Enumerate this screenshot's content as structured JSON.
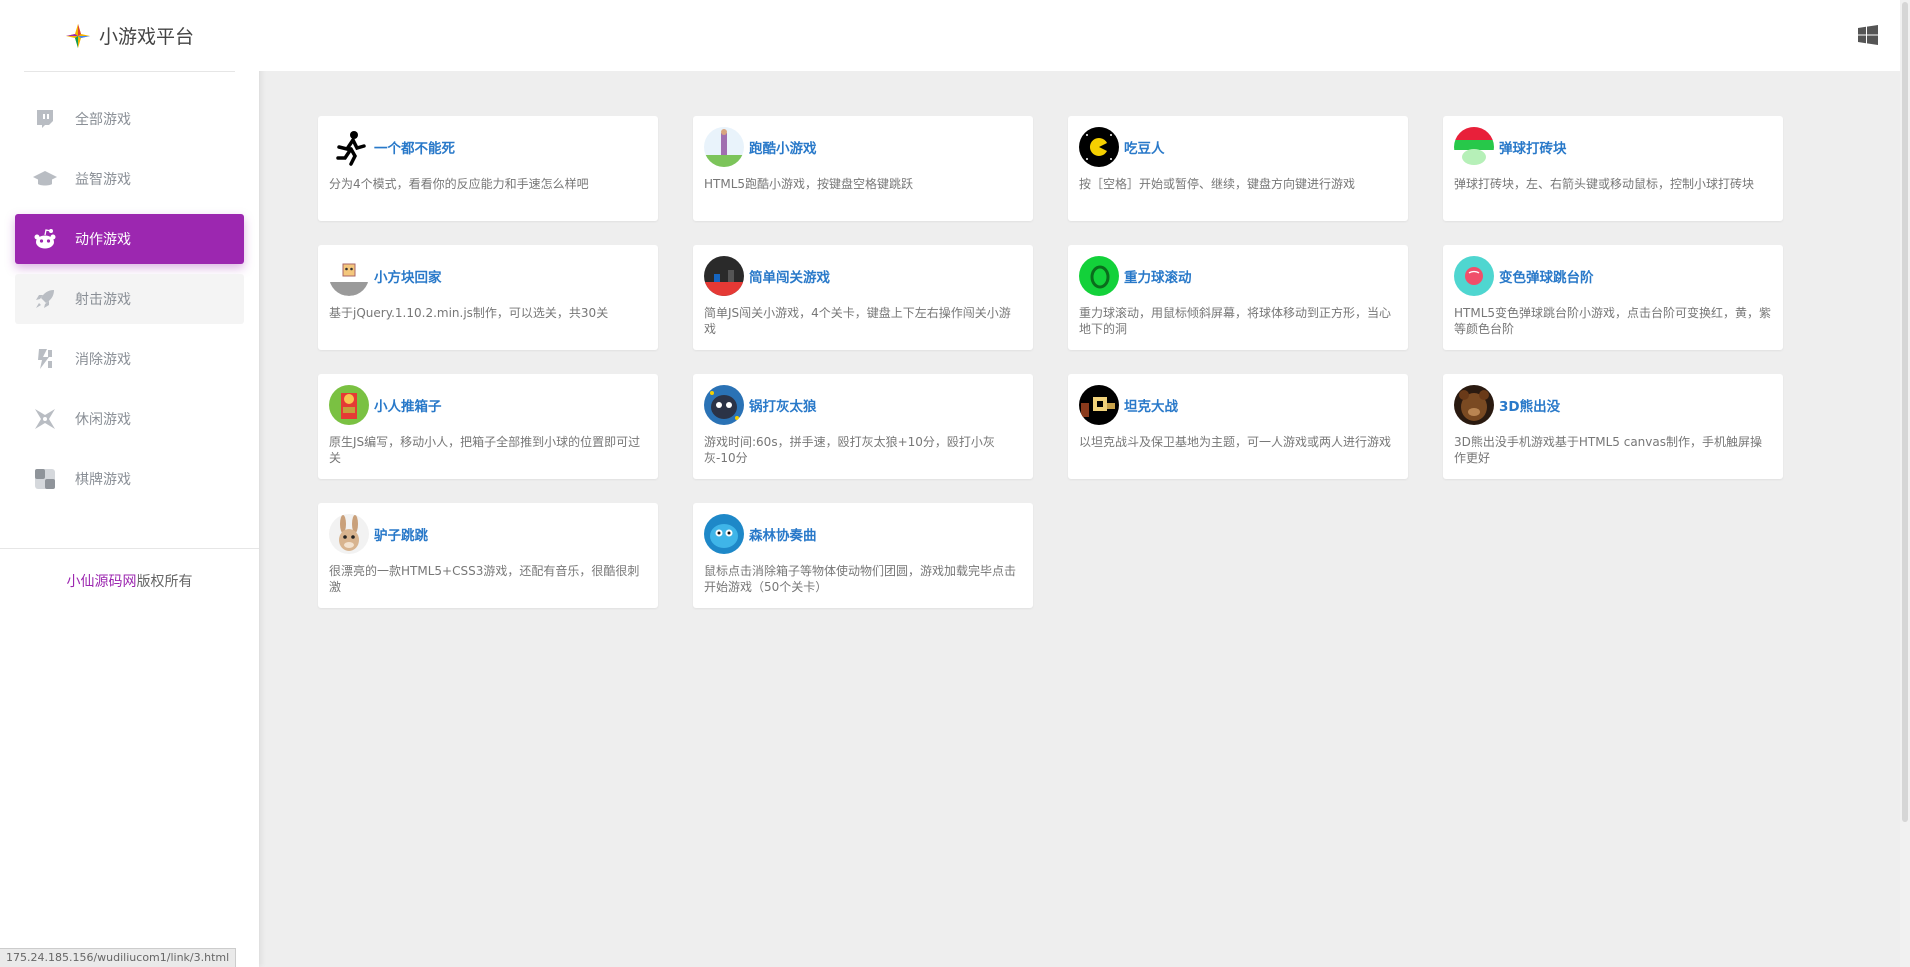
{
  "brand": {
    "title": "小游戏平台"
  },
  "nav": [
    {
      "label": "全部游戏",
      "icon": "twitch-icon"
    },
    {
      "label": "益智游戏",
      "icon": "graduation-cap-icon"
    },
    {
      "label": "动作游戏",
      "icon": "reddit-icon",
      "active": true
    },
    {
      "label": "射击游戏",
      "icon": "rocket-icon"
    },
    {
      "label": "消除游戏",
      "icon": "bolt-box-icon"
    },
    {
      "label": "休闲游戏",
      "icon": "shuriken-icon"
    },
    {
      "label": "棋牌游戏",
      "icon": "checkerboard-icon"
    }
  ],
  "copyright": {
    "link": "小仙源码网",
    "text": "版权所有"
  },
  "status_url": "175.24.185.156/wudiliucom1/link/3.html",
  "games": [
    {
      "title": "一个都不能死",
      "desc": "分为4个模式，看看你的反应能力和手速怎么样吧"
    },
    {
      "title": "跑酷小游戏",
      "desc": "HTML5跑酷小游戏，按键盘空格键跳跃"
    },
    {
      "title": "吃豆人",
      "desc": "按［空格］开始或暂停、继续，键盘方向键进行游戏"
    },
    {
      "title": "弹球打砖块",
      "desc": "弹球打砖块，左、右箭头键或移动鼠标，控制小球打砖块"
    },
    {
      "title": "小方块回家",
      "desc": "基于jQuery.1.10.2.min.js制作，可以选关，共30关"
    },
    {
      "title": "简单闯关游戏",
      "desc": "简单JS闯关小游戏，4个关卡，键盘上下左右操作闯关小游戏"
    },
    {
      "title": "重力球滚动",
      "desc": "重力球滚动，用鼠标倾斜屏幕，将球体移动到正方形，当心地下的洞"
    },
    {
      "title": "变色弹球跳台阶",
      "desc": "HTML5变色弹球跳台阶小游戏，点击台阶可变换红，黄，紫等颜色台阶"
    },
    {
      "title": "小人推箱子",
      "desc": "原生JS编写，移动小人，把箱子全部推到小球的位置即可过关"
    },
    {
      "title": "锅打灰太狼",
      "desc": "游戏时间:60s，拼手速，殴打灰太狼+10分，殴打小灰灰-10分"
    },
    {
      "title": "坦克大战",
      "desc": "以坦克战斗及保卫基地为主题，可一人游戏或两人进行游戏"
    },
    {
      "title": "3D熊出没",
      "desc": "3D熊出没手机游戏基于HTML5 canvas制作，手机触屏操作更好"
    },
    {
      "title": "驴子跳跳",
      "desc": "很漂亮的一款HTML5+CSS3游戏，还配有音乐，很酷很刺激"
    },
    {
      "title": "森林协奏曲",
      "desc": "鼠标点击消除箱子等物体使动物们团圆，游戏加载完毕点击开始游戏（50个关卡）"
    }
  ],
  "colors": {
    "accent": "#9c27b0",
    "title_link": "#2979c9",
    "background": "#eeeeee"
  }
}
